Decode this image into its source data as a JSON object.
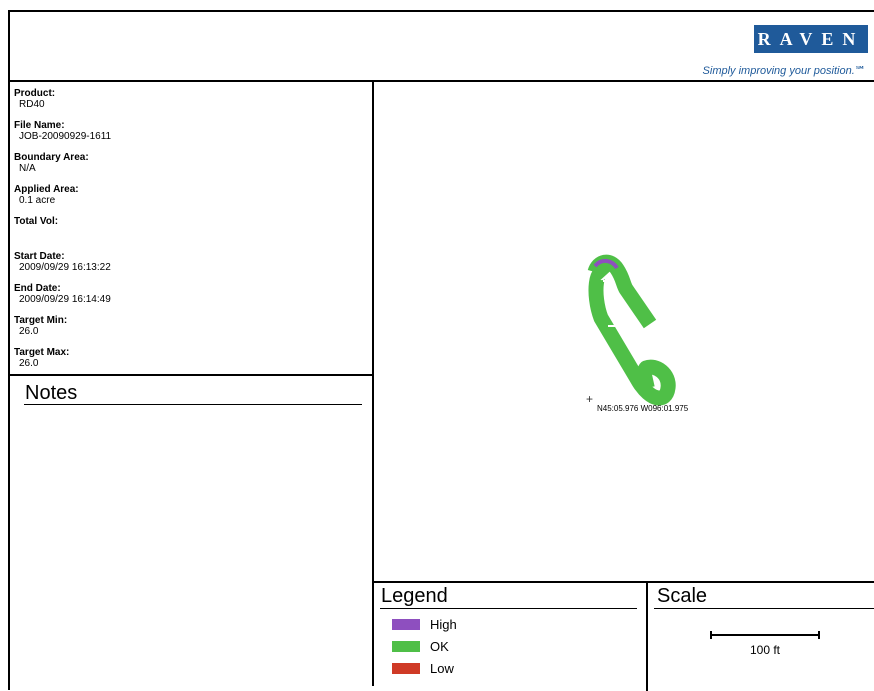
{
  "header": {
    "brand": "RAVEN",
    "tagline": "Simply improving your position.℠"
  },
  "info": {
    "product": {
      "label": "Product:",
      "value": "RD40"
    },
    "file_name": {
      "label": "File Name:",
      "value": "JOB-20090929-1611"
    },
    "boundary_area": {
      "label": "Boundary Area:",
      "value": "N/A"
    },
    "applied_area": {
      "label": "Applied Area:",
      "value": "0.1 acre"
    },
    "total_vol": {
      "label": "Total Vol:",
      "value": ""
    },
    "start_date": {
      "label": "Start Date:",
      "value": "2009/09/29 16:13:22"
    },
    "end_date": {
      "label": "End Date:",
      "value": "2009/09/29 16:14:49"
    },
    "target_min": {
      "label": "Target Min:",
      "value": "26.0"
    },
    "target_max": {
      "label": "Target Max:",
      "value": "26.0"
    }
  },
  "notes": {
    "title": "Notes"
  },
  "map": {
    "coordinate": "N45:05.976 W096:01.975",
    "colors": {
      "ok": "#4fbf47",
      "high": "#8e4fbf"
    }
  },
  "legend": {
    "title": "Legend",
    "items": [
      {
        "label": "High",
        "color": "#8e4fbf"
      },
      {
        "label": "OK",
        "color": "#4fbf47"
      },
      {
        "label": "Low",
        "color": "#cf3a26"
      }
    ]
  },
  "scale": {
    "title": "Scale",
    "label": "100 ft"
  }
}
